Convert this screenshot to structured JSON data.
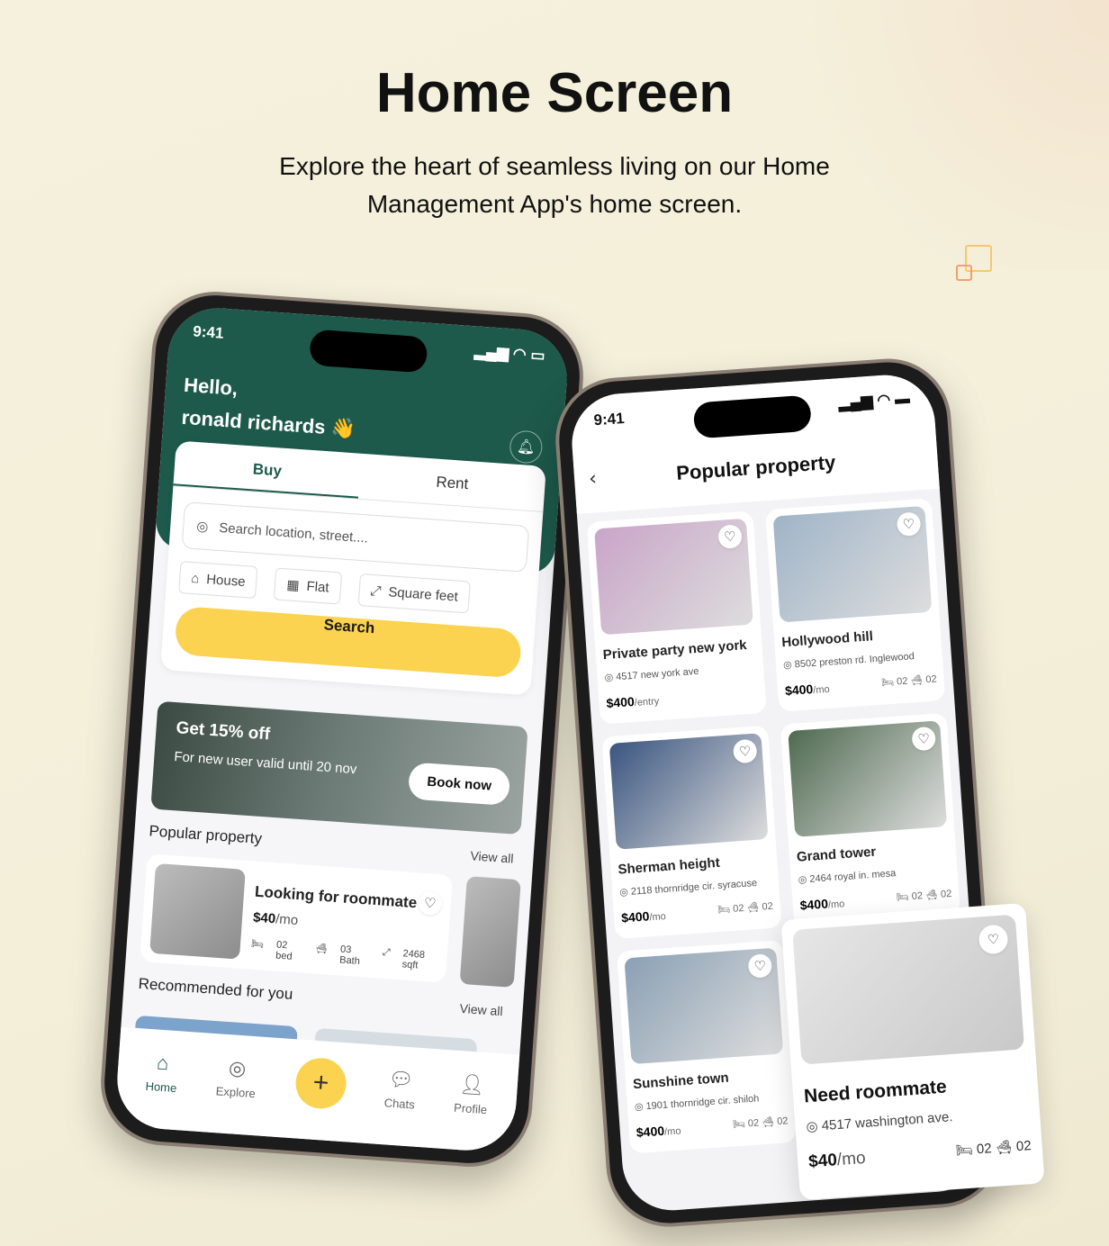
{
  "title": "Home Screen",
  "subtitle_line1": "Explore the heart of seamless living on our Home",
  "subtitle_line2": "Management App's home screen.",
  "colors": {
    "primary": "#1d5a4b",
    "accent": "#fbd350",
    "background": "#f5f1dc"
  },
  "home": {
    "time": "9:41",
    "greeting": "Hello,",
    "user": "ronald richards 👋",
    "tabs": [
      "Buy",
      "Rent"
    ],
    "search_placeholder": "Search location, street....",
    "chips": [
      {
        "label": "House",
        "icon": "house-icon"
      },
      {
        "label": "Flat",
        "icon": "building-icon"
      },
      {
        "label": "Square feet",
        "icon": "resize-icon"
      }
    ],
    "search_button": "Search",
    "promo": {
      "title": "Get 15% off",
      "text": "For new user valid until 20 nov",
      "button": "Book now"
    },
    "popular_title": "Popular property",
    "view_all": "View all",
    "roommate": {
      "title": "Looking for roommate",
      "price": "$40",
      "unit": "/mo",
      "bed": "02 bed",
      "bath": "03 Bath",
      "area": "2468 sqft"
    },
    "recommended_title": "Recommended for you",
    "nav": [
      "Home",
      "Explore",
      "Chats",
      "Profile"
    ]
  },
  "popular": {
    "time": "9:41",
    "title": "Popular property",
    "items": [
      {
        "name": "Private party new york",
        "addr": "4517 new york ave",
        "price": "$400",
        "unit": "/entry",
        "bed": "",
        "bath": "",
        "img": "#c9a5c8"
      },
      {
        "name": "Hollywood hill",
        "addr": "8502 preston rd. Inglewood",
        "price": "$400",
        "unit": "/mo",
        "bed": "02",
        "bath": "02",
        "img": "#9fb4c8"
      },
      {
        "name": "Sherman height",
        "addr": "2118 thornridge cir. syracuse",
        "price": "$400",
        "unit": "/mo",
        "bed": "02",
        "bath": "02",
        "img": "#3a5580"
      },
      {
        "name": "Grand tower",
        "addr": "2464 royal in. mesa",
        "price": "$400",
        "unit": "/mo",
        "bed": "02",
        "bath": "02",
        "img": "#4f6a50"
      },
      {
        "name": "Sunshine town",
        "addr": "1901 thornridge cir. shiloh",
        "price": "$400",
        "unit": "/mo",
        "bed": "02",
        "bath": "02",
        "img": "#8aa0b4"
      }
    ]
  },
  "float_card": {
    "name": "Need roommate",
    "addr": "4517 washington ave.",
    "price": "$40",
    "unit": "/mo",
    "bed": "02",
    "bath": "02"
  }
}
